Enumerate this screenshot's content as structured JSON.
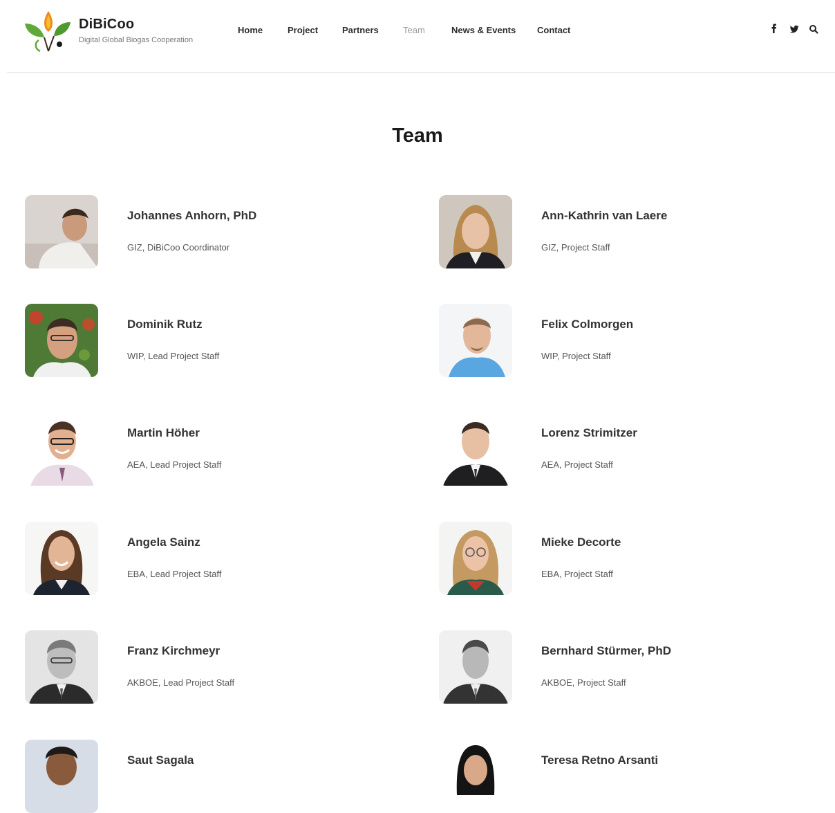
{
  "brand": {
    "name": "DiBiCoo",
    "tagline": "Digital Global Biogas Cooperation"
  },
  "nav": [
    {
      "label": "Home",
      "active": false
    },
    {
      "label": "Project",
      "active": false
    },
    {
      "label": "Partners",
      "active": false
    },
    {
      "label": "Team",
      "active": true
    },
    {
      "label": "News & Events",
      "active": false
    },
    {
      "label": "Contact",
      "active": false
    }
  ],
  "social_icons": [
    "facebook-icon",
    "twitter-icon",
    "search-icon"
  ],
  "page_title": "Team",
  "members": [
    {
      "name": "Johannes Anhorn, PhD",
      "role": "GIZ, DiBiCoo Coordinator",
      "photo": "color"
    },
    {
      "name": "Ann-Kathrin van Laere",
      "role": "GIZ, Project Staff",
      "photo": "color"
    },
    {
      "name": "Dominik Rutz",
      "role": "WIP, Lead Project Staff",
      "photo": "color"
    },
    {
      "name": "Felix Colmorgen",
      "role": "WIP, Project Staff",
      "photo": "color"
    },
    {
      "name": "Martin Höher",
      "role": "AEA, Lead Project Staff",
      "photo": "color"
    },
    {
      "name": "Lorenz Strimitzer",
      "role": "AEA, Project Staff",
      "photo": "color"
    },
    {
      "name": "Angela Sainz",
      "role": "EBA, Lead Project Staff",
      "photo": "color"
    },
    {
      "name": "Mieke Decorte",
      "role": "EBA, Project Staff",
      "photo": "color"
    },
    {
      "name": "Franz Kirchmeyr",
      "role": "AKBOE, Lead Project Staff",
      "photo": "grayscale"
    },
    {
      "name": "Bernhard Stürmer, PhD",
      "role": "AKBOE, Project Staff",
      "photo": "grayscale"
    },
    {
      "name": "Saut Sagala",
      "role": "",
      "photo": "color"
    },
    {
      "name": "Teresa Retno Arsanti",
      "role": "",
      "photo": "color"
    }
  ],
  "colors": {
    "accent_orange": "#f28a1e",
    "leaf_green": "#5fa83a",
    "text_dark": "#333333",
    "nav_active": "#9a9a9a"
  }
}
